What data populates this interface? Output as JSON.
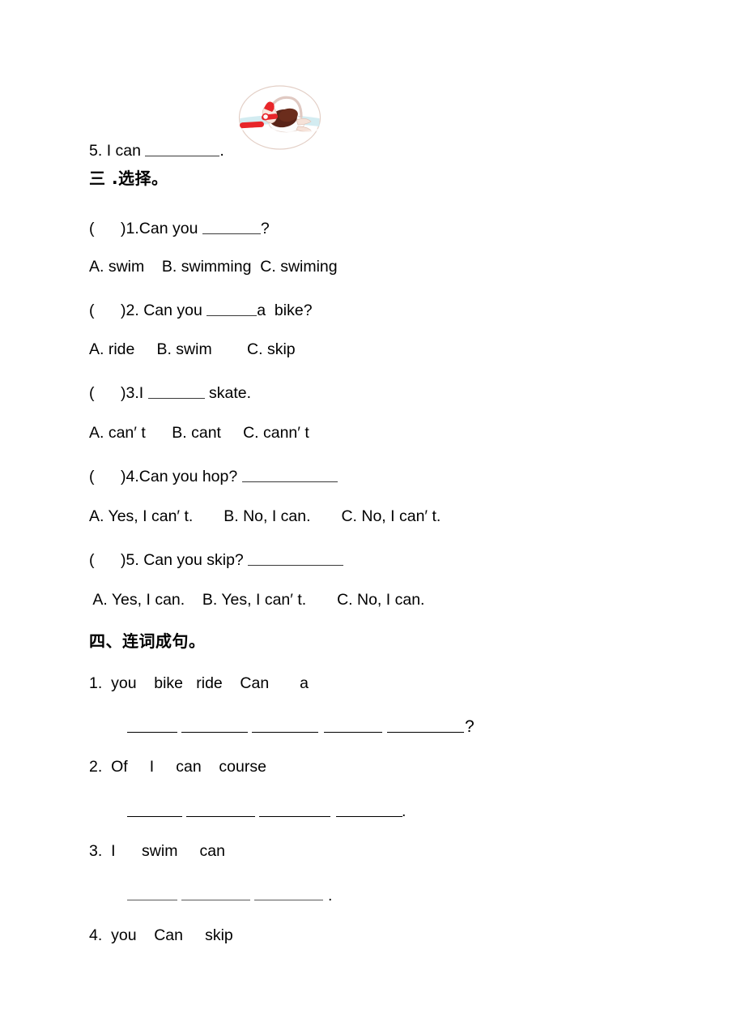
{
  "document": {
    "type": "english-worksheet",
    "language": "zh-CN"
  },
  "illustration": {
    "name": "swimming-illustration",
    "description": "girl swimming in water with red kickboard",
    "colors": {
      "water": "#bfe4ec",
      "water_edge": "#d8eef3",
      "kickboard": "#e8262a",
      "cap": "#e8262a",
      "hair": "#5a2418",
      "skin": "#f6e2d8",
      "outline": "#c8a89a"
    }
  },
  "fill_in": {
    "item5": {
      "number": "5.",
      "text_before": "I can",
      "blank": "__________",
      "text_after": "."
    }
  },
  "section_three": {
    "heading": "三 .选择。",
    "questions": [
      {
        "bracket_open": "(",
        "bracket_close": ")",
        "number": "1.",
        "stem_before": "Can you ",
        "stem_blank": "_______",
        "stem_after": "?",
        "options_line": "A. swim    B. swimming  C. swiming",
        "options": [
          {
            "label": "A.",
            "text": "swim"
          },
          {
            "label": "B.",
            "text": "swimming"
          },
          {
            "label": "C.",
            "text": "swiming"
          }
        ]
      },
      {
        "bracket_open": "(",
        "bracket_close": ")",
        "number": "2.",
        "stem_before": " Can you ",
        "stem_blank": "______",
        "stem_after": "a  bike?",
        "options_line": "A. ride     B. swim        C. skip",
        "options": [
          {
            "label": "A.",
            "text": "ride"
          },
          {
            "label": "B.",
            "text": "swim"
          },
          {
            "label": "C.",
            "text": "skip"
          }
        ]
      },
      {
        "bracket_open": "(",
        "bracket_close": ")",
        "number": "3.",
        "stem_before": "I ",
        "stem_blank": "_______",
        "stem_after": " skate.",
        "options_line": "A. can′ t      B. cant     C. cann′ t",
        "options": [
          {
            "label": "A.",
            "text": "can′ t"
          },
          {
            "label": "B.",
            "text": "cant"
          },
          {
            "label": "C.",
            "text": "cann′ t"
          }
        ]
      },
      {
        "bracket_open": "(",
        "bracket_close": ")",
        "number": "4.",
        "stem_before": "Can you hop? ",
        "stem_blank": "____________",
        "stem_after": "",
        "options_line": "A. Yes, I can′ t.       B. No, I can.       C. No, I can′ t.",
        "options": [
          {
            "label": "A.",
            "text": "Yes, I can′ t."
          },
          {
            "label": "B.",
            "text": "No, I can."
          },
          {
            "label": "C.",
            "text": "No, I can′ t."
          }
        ]
      },
      {
        "bracket_open": "(",
        "bracket_close": ")",
        "number": "5.",
        "stem_before": " Can you skip? ",
        "stem_blank": "____________",
        "stem_after": "",
        "options_line": " A. Yes, I can.    B. Yes, I can′ t.       C. No, I can.",
        "options": [
          {
            "label": "A.",
            "text": "Yes, I can."
          },
          {
            "label": "B.",
            "text": "Yes, I can′ t."
          },
          {
            "label": "C.",
            "text": "No, I can."
          }
        ]
      }
    ]
  },
  "section_four": {
    "heading": "四、连词成句。",
    "items": [
      {
        "number": "1.",
        "words_line": "you    bike   ride    Can       a",
        "words": [
          "you",
          "bike",
          "ride",
          "Can",
          "a"
        ],
        "end_punct": "?",
        "blank_count": 5
      },
      {
        "number": "2.",
        "words_line": "Of     I     can    course",
        "words": [
          "Of",
          "I",
          "can",
          "course"
        ],
        "end_punct": ".",
        "blank_count": 4
      },
      {
        "number": "3.",
        "words_line": "I      swim     can",
        "words": [
          "I",
          "swim",
          "can"
        ],
        "end_punct": ".",
        "blank_count": 3
      },
      {
        "number": "4.",
        "words_line": "you    Can     skip",
        "words": [
          "you",
          "Can",
          "skip"
        ],
        "end_punct": "",
        "blank_count": 0
      }
    ]
  }
}
